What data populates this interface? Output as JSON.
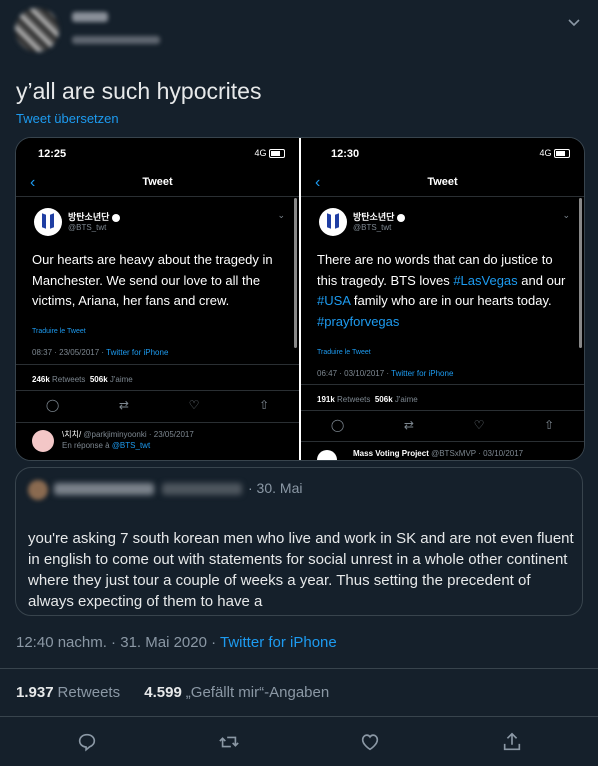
{
  "tweet": {
    "text": "y’all are such hypocrites",
    "translate_label": "Tweet übersetzen",
    "timestamp": "12:40 nachm. · 31. Mai 2020",
    "separator": " · ",
    "source": "Twitter for iPhone",
    "retweets_count": "1.937",
    "retweets_label": "Retweets",
    "likes_count": "4.599",
    "likes_label": "„Gefällt mir“-Angaben"
  },
  "screenshot_left": {
    "time": "12:25",
    "status": "4G",
    "title": "Tweet",
    "account_name": "방탄소년단",
    "account_handle": "@BTS_twt",
    "body": "Our hearts are heavy about the tragedy in Manchester. We send our love to all the victims, Ariana, her fans and crew.",
    "translate": "Traduire le Tweet",
    "meta_time": "08:37 · 23/05/2017 · ",
    "meta_source": "Twitter for iPhone",
    "retweets_count": "246k",
    "retweets_label": "Retweets",
    "likes_count": "506k",
    "likes_label": "J'aime",
    "reply_name": "\\치치/",
    "reply_handle": "@parkjiminyoonki · 23/05/2017",
    "reply_sub": "En réponse à ",
    "reply_to": "@BTS_twt"
  },
  "screenshot_right": {
    "time": "12:30",
    "status": "4G",
    "title": "Tweet",
    "account_name": "방탄소년단",
    "account_handle": "@BTS_twt",
    "body_1": "There are no words that can do justice to this tragedy. BTS loves ",
    "tag_1": "#LasVegas",
    "body_2": " and our ",
    "tag_2": "#USA",
    "body_3": " family who are in our hearts today. ",
    "tag_3": "#prayforvegas",
    "translate": "Traduire le Tweet",
    "meta_time": "06:47 · 03/10/2017 · ",
    "meta_source": "Twitter for iPhone",
    "retweets_count": "191k",
    "retweets_label": "Retweets",
    "likes_count": "506k",
    "likes_label": "J'aime",
    "next_name": "Mass Voting Project",
    "next_handle": " @BTSxMVP · 03/10/2017"
  },
  "quote": {
    "date": "· 30. Mai",
    "text": "you're asking 7 south korean men who live and work in SK and are not even fluent in english to come out with statements for social unrest in a whole other continent where they just tour a couple of weeks a year. Thus setting the precedent of always expecting of them to have a"
  },
  "icons": {
    "reply": "reply-icon",
    "retweet": "retweet-icon",
    "like": "heart-icon",
    "share": "share-icon",
    "menu": "chevron-down-icon"
  },
  "colors": {
    "background": "#15202b",
    "accent": "#1d9bf0",
    "secondary_text": "#8b98a5",
    "border": "#38444d"
  }
}
